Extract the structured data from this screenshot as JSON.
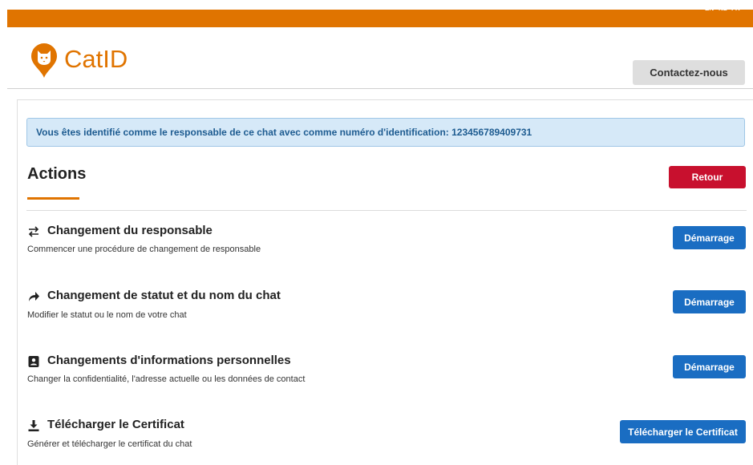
{
  "header": {
    "brand": "CatID",
    "languages": [
      "EN",
      "NL",
      "FR"
    ],
    "contact_label": "Contactez-nous",
    "accent_color": "#e07400"
  },
  "info": {
    "message": "Vous êtes identifié comme le responsable de ce chat avec comme numéro d'identification: 123456789409731"
  },
  "actions": {
    "title": "Actions",
    "back_label": "Retour",
    "items": [
      {
        "icon": "swap-arrows-icon",
        "title": "Changement du responsable",
        "description": "Commencer une procédure de changement de responsable",
        "button": "Démarrage"
      },
      {
        "icon": "share-arrow-icon",
        "title": "Changement de statut et du nom du chat",
        "description": "Modifier le statut ou le nom de votre chat",
        "button": "Démarrage"
      },
      {
        "icon": "contact-card-icon",
        "title": "Changements d'informations personnelles",
        "description": "Changer la confidentialité, l'adresse actuelle ou les données de contact",
        "button": "Démarrage"
      },
      {
        "icon": "download-icon",
        "title": "Télécharger le Certificat",
        "description": "Générer et télécharger le certificat du chat",
        "button": "Télécharger le Certificat"
      }
    ]
  }
}
